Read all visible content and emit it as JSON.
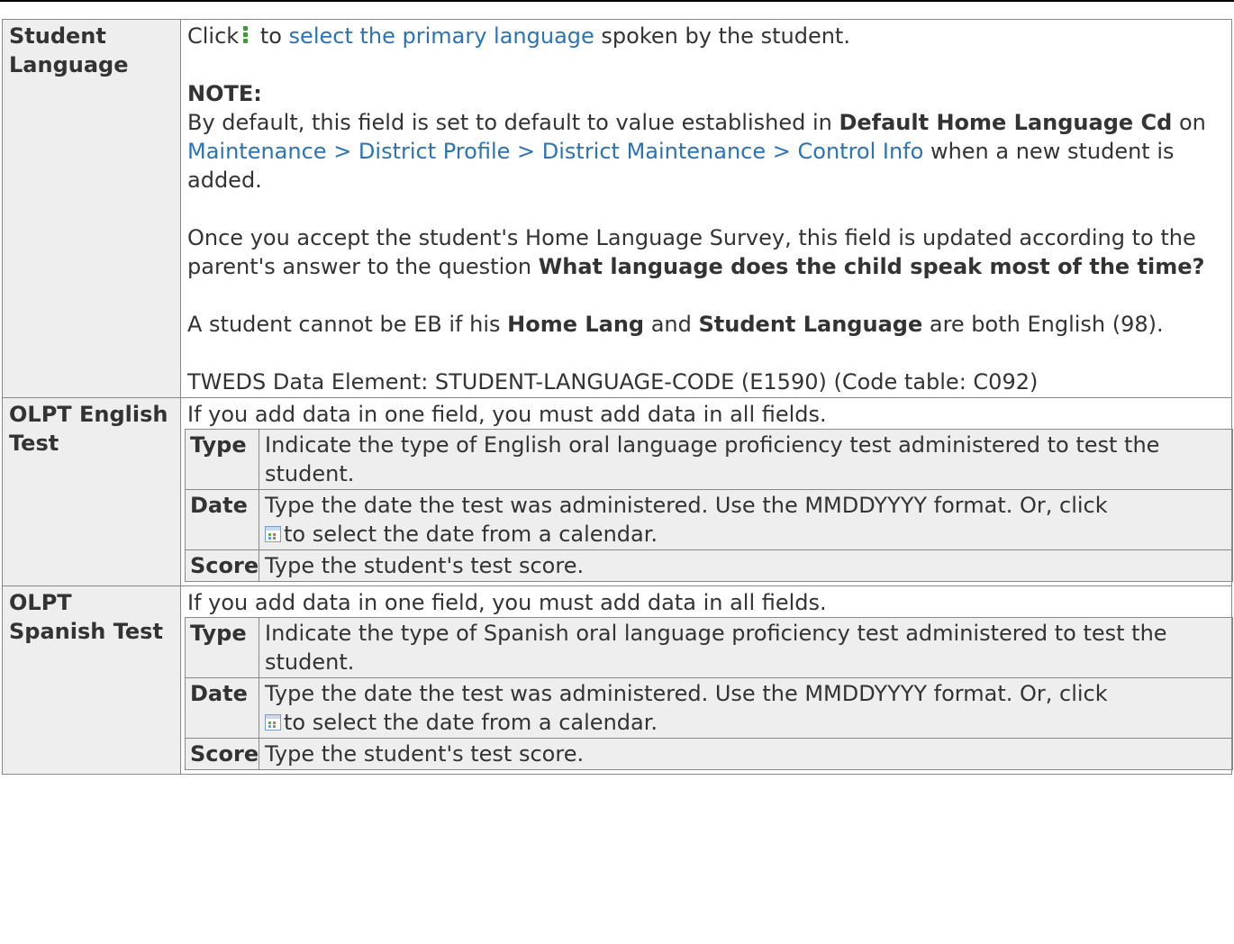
{
  "rows": {
    "student_language": {
      "label": "Student Language",
      "line1_click": "Click",
      "line1_to": " to ",
      "line1_link": "select the primary language",
      "line1_rest": " spoken by the student.",
      "note_heading": "NOTE:",
      "default_p1": "By default, this field is set to default to value established in ",
      "default_b1": "Default Home Language Cd",
      "default_p2": " on ",
      "default_link": "Maintenance > District Profile > District Maintenance > Control Info",
      "default_p3": " when a new student is added.",
      "accept_p1": "Once you accept the student's Home Language Survey, this field is updated according to the parent's answer to the question ",
      "accept_b1": "What language does the child speak most of the time?",
      "eb_p1": "A student cannot be EB if his ",
      "eb_b1": "Home Lang",
      "eb_p2": " and ",
      "eb_b2": "Student Language",
      "eb_p3": " are both English (98).",
      "tweds": "TWEDS Data Element: STUDENT-LANGUAGE-CODE (E1590) (Code table: C092)"
    },
    "olpt_english": {
      "label": "OLPT English Test",
      "intro": "If you add data in one field, you must add data in all fields.",
      "type_label": "Type",
      "type_desc": "Indicate the type of English oral language proficiency test administered to test the student.",
      "date_label": "Date",
      "date_desc1": "Type the date the test was administered. Use the MMDDYYYY format. Or, click",
      "date_desc2": "to select the date from a calendar.",
      "score_label": "Score",
      "score_desc": "Type the student's test score."
    },
    "olpt_spanish": {
      "label": "OLPT Spanish Test",
      "intro": "If you add data in one field, you must add data in all fields.",
      "type_label": "Type",
      "type_desc": "Indicate the type of Spanish oral language proficiency test administered to test the student.",
      "date_label": "Date",
      "date_desc1": "Type the date the test was administered. Use the MMDDYYYY format. Or, click",
      "date_desc2": "to select the date from a calendar.",
      "score_label": "Score",
      "score_desc": "Type the student's test score."
    }
  },
  "icons": {
    "kebab": "kebab-menu-icon",
    "calendar": "calendar-icon"
  },
  "colors": {
    "link": "#2b73b7",
    "label_bg": "#eeeeee",
    "border": "#888888",
    "kebab": "#3e9a33"
  }
}
